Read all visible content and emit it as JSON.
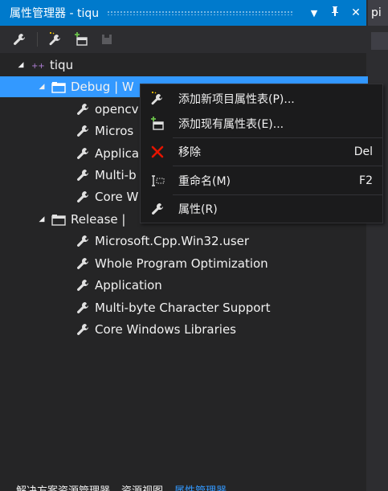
{
  "window": {
    "title": "属性管理器 - tiqu",
    "dropdown_glyph": "▼",
    "pin_glyph": "ꟷ",
    "close_glyph": "✕",
    "right_tab_label": "pi"
  },
  "tree": {
    "root": "tiqu",
    "configs": [
      {
        "label": "Debug | W",
        "items": [
          "opencv",
          "Micros",
          "Applica",
          "Multi-b",
          "Core W"
        ]
      },
      {
        "label": "Release | ",
        "items": [
          "Microsoft.Cpp.Win32.user",
          "Whole Program Optimization",
          "Application",
          "Multi-byte Character Support",
          "Core Windows Libraries"
        ]
      }
    ]
  },
  "context_menu": {
    "items": [
      {
        "label": "添加新项目属性表(P)...",
        "shortcut": ""
      },
      {
        "label": "添加现有属性表(E)...",
        "shortcut": ""
      },
      {
        "label": "移除",
        "shortcut": "Del"
      },
      {
        "label": "重命名(M)",
        "shortcut": "F2"
      },
      {
        "label": "属性(R)",
        "shortcut": ""
      }
    ]
  },
  "bottom_tabs": [
    "解决方案资源管理器",
    "资源视图",
    "属性管理器"
  ],
  "colors": {
    "accent": "#007acc",
    "selection": "#3399ff",
    "remove_icon": "#e51400",
    "project_icon": "#68217a"
  }
}
